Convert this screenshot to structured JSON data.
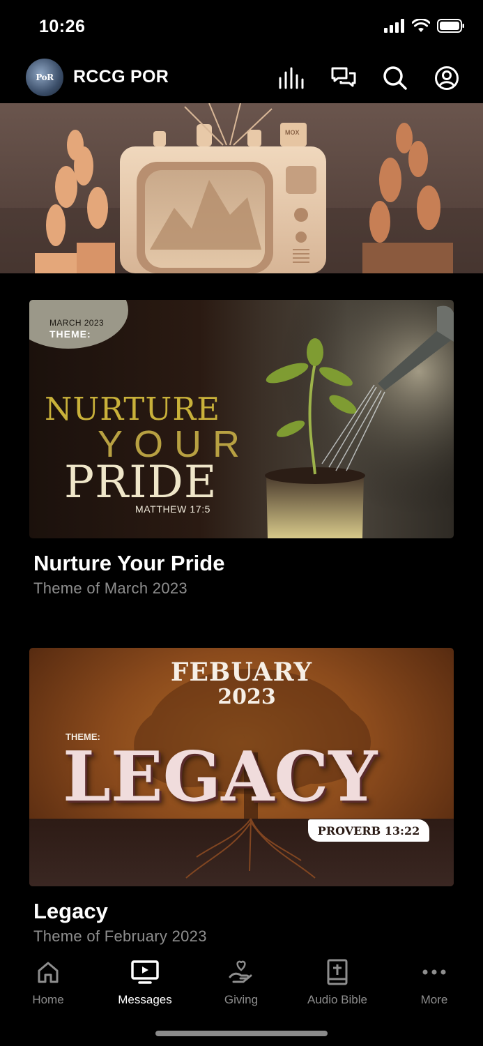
{
  "status_bar": {
    "time": "10:26"
  },
  "header": {
    "logo_text": "PoR",
    "title": "RCCG POR",
    "actions": [
      "live-audio-icon",
      "chat-icon",
      "search-icon",
      "profile-icon"
    ]
  },
  "hero": {
    "tv_label": "MOX"
  },
  "messages": [
    {
      "art_badge_month": "MARCH 2023",
      "art_badge_label": "THEME:",
      "art_line1": "NURTURE",
      "art_line2": "YOUR",
      "art_line3": "PRIDE",
      "art_verse": "MATTHEW 17:5",
      "title": "Nurture Your Pride",
      "subtitle": "Theme of March 2023"
    },
    {
      "art_month": "FEBUARY",
      "art_year": "2023",
      "art_theme": "THEME:",
      "art_word": "LEGACY",
      "art_verse": "PROVERB 13:22",
      "title": "Legacy",
      "subtitle": "Theme of February 2023"
    }
  ],
  "nav": {
    "items": [
      {
        "label": "Home",
        "icon": "home-icon"
      },
      {
        "label": "Messages",
        "icon": "tv-icon"
      },
      {
        "label": "Giving",
        "icon": "giving-icon"
      },
      {
        "label": "Audio Bible",
        "icon": "bible-icon"
      },
      {
        "label": "More",
        "icon": "more-icon"
      }
    ],
    "active_index": 1
  },
  "colors": {
    "background": "#000000",
    "inactive": "#8e8e8e",
    "active": "#ffffff",
    "subtitle": "#8f8f8f"
  }
}
